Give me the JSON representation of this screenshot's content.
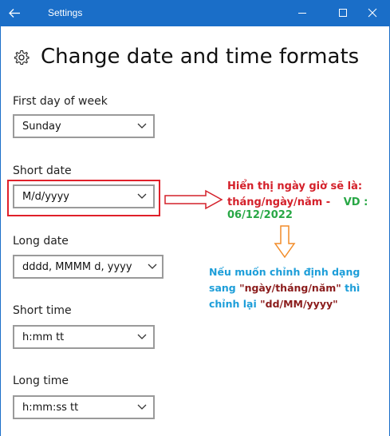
{
  "window": {
    "title": "Settings",
    "controls": [
      "minimize-icon",
      "maximize-icon",
      "close-icon"
    ],
    "accent": "#1a6ec8"
  },
  "page": {
    "title": "Change date and time formats",
    "icon": "gear-icon"
  },
  "fields": {
    "first_day": {
      "label": "First day of week",
      "value": "Sunday"
    },
    "short_date": {
      "label": "Short date",
      "value": "M/d/yyyy"
    },
    "long_date": {
      "label": "Long date",
      "value": "dddd, MMMM d, yyyy"
    },
    "short_time": {
      "label": "Short time",
      "value": "h:mm tt"
    },
    "long_time": {
      "label": "Long time",
      "value": "h:mm:ss tt"
    }
  },
  "annotations": {
    "line1": "Hiển thị ngày giờ sẽ là:",
    "line2a": "tháng/ngày/năm  -",
    "line2b": "VD :",
    "line3": "06/12/2022",
    "blue1": "Nếu muốn chỉnh định dạng",
    "blue2a": "sang ",
    "blue2b": "\"ngày/tháng/năm\"",
    "blue2c": " thì",
    "blue3a": "chỉnh lại  ",
    "blue3b": "\"dd/MM/yyyy\"",
    "colors": {
      "red": "#d4202a",
      "green": "#28a745",
      "blue": "#1d9ed9",
      "orange": "#f28c28"
    }
  }
}
